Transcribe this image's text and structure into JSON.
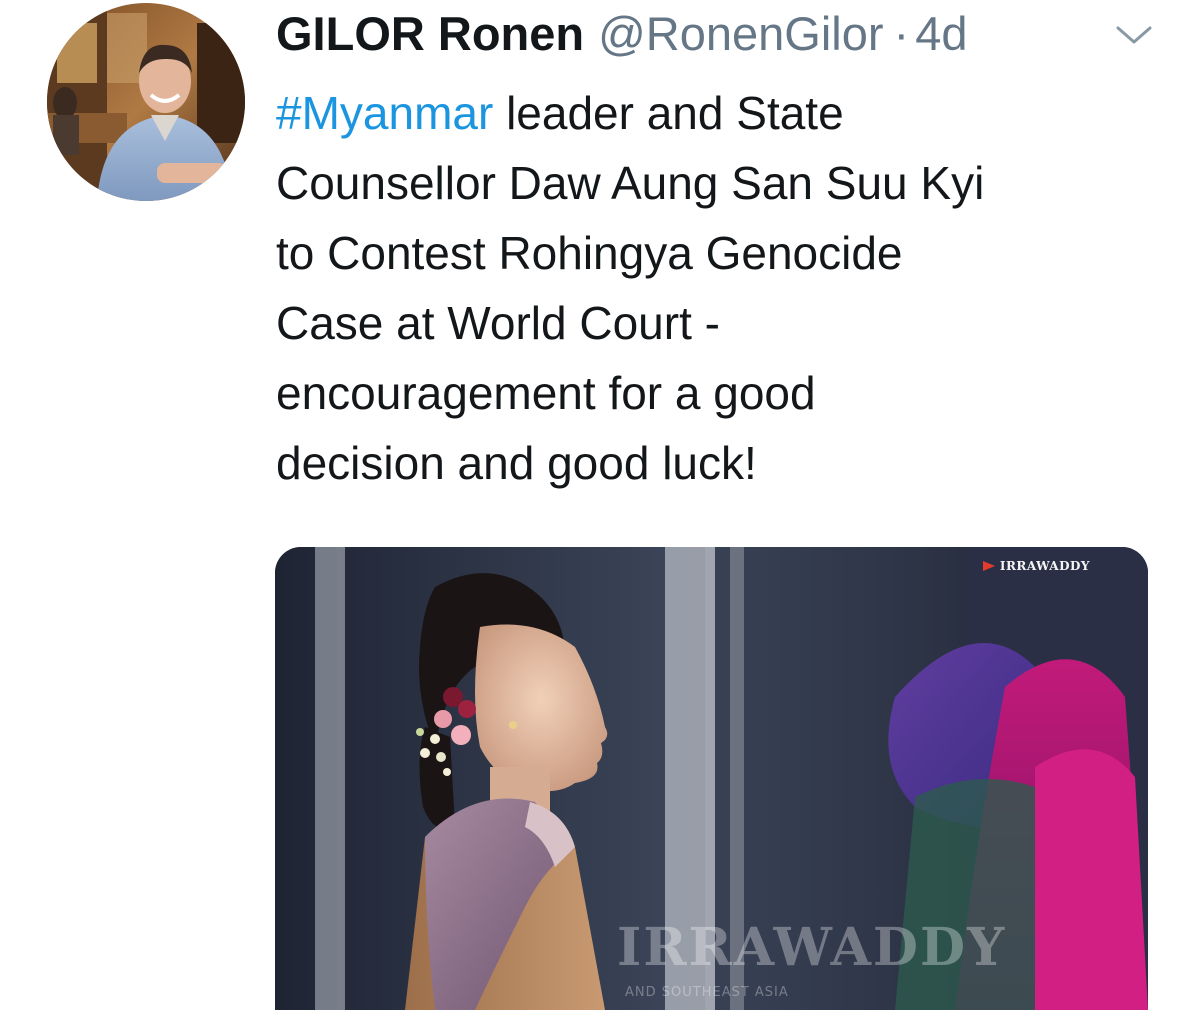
{
  "tweet": {
    "display_name": "GILOR Ronen",
    "handle": "@RonenGilor",
    "separator": "·",
    "timestamp": "4d",
    "text_lines": [
      {
        "hashtag": "#Myanmar",
        "rest": " leader and State"
      },
      "Counsellor Daw Aung San Suu Kyi",
      "to Contest Rohingya Genocide",
      "Case at World Court -",
      "encouragement for a good",
      "decision and good luck!"
    ],
    "icons": {
      "avatar": "user-avatar-photo",
      "menu": "chevron-down-icon"
    },
    "colors": {
      "text": "#14171a",
      "secondary": "#657786",
      "link": "#1b95e0"
    }
  },
  "media": {
    "source_logo": "IRRAWADDY",
    "watermark": "IRRAWADDY",
    "watermark_sub": "AND SOUTHEAST ASIA"
  }
}
